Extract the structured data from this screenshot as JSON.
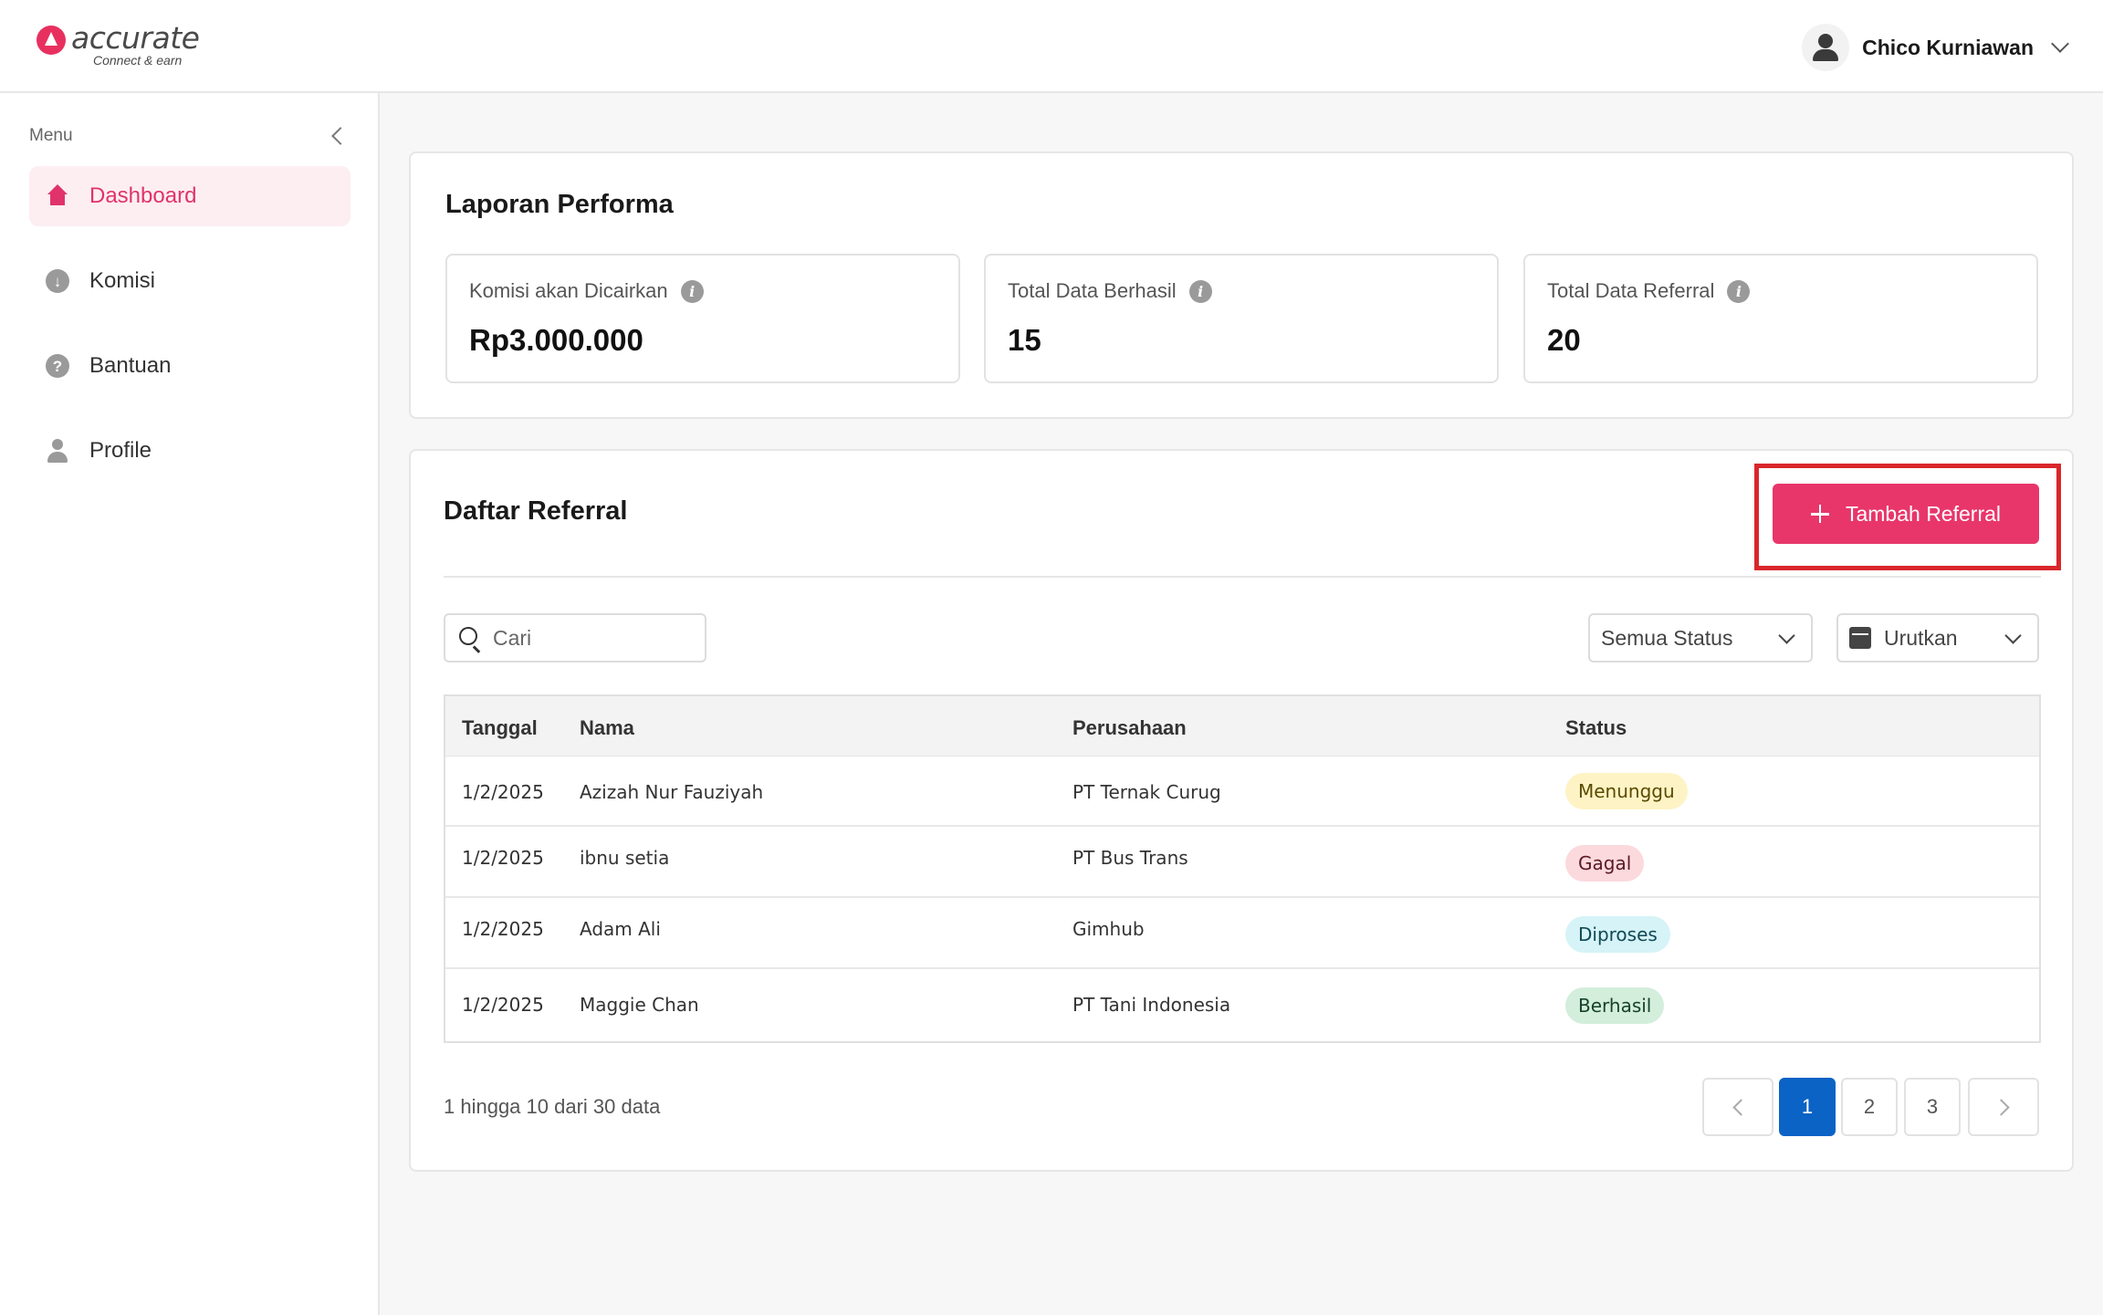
{
  "brand": {
    "name": "accurate",
    "tagline": "Connect & earn"
  },
  "header": {
    "user_name": "Chico Kurniawan"
  },
  "sidebar": {
    "menu_label": "Menu",
    "items": [
      {
        "label": "Dashboard",
        "icon": "home-icon",
        "active": true
      },
      {
        "label": "Komisi",
        "icon": "download-circle-icon",
        "active": false
      },
      {
        "label": "Bantuan",
        "icon": "help-circle-icon",
        "active": false
      },
      {
        "label": "Profile",
        "icon": "person-icon",
        "active": false
      }
    ]
  },
  "performance": {
    "title": "Laporan Performa",
    "stats": [
      {
        "label": "Komisi akan Dicairkan",
        "value": "Rp3.000.000"
      },
      {
        "label": "Total Data Berhasil",
        "value": "15"
      },
      {
        "label": "Total Data Referral",
        "value": "20"
      }
    ]
  },
  "referrals": {
    "title": "Daftar Referral",
    "add_button": "Tambah Referral",
    "search_placeholder": "Cari",
    "status_filter": "Semua Status",
    "sort_label": "Urutkan",
    "columns": [
      "Tanggal",
      "Nama",
      "Perusahaan",
      "Status"
    ],
    "rows": [
      {
        "date": "1/2/2025",
        "name": "Azizah Nur Fauziyah",
        "company": "PT Ternak Curug",
        "status": "Menunggu"
      },
      {
        "date": "1/2/2025",
        "name": "ibnu setia",
        "company": "PT Bus Trans",
        "status": "Gagal"
      },
      {
        "date": "1/2/2025",
        "name": "Adam Ali",
        "company": "Gimhub",
        "status": "Diproses"
      },
      {
        "date": "1/2/2025",
        "name": "Maggie Chan",
        "company": "PT Tani Indonesia",
        "status": "Berhasil"
      }
    ],
    "status_colors": {
      "Menunggu": {
        "bg": "#fdf3c4",
        "fg": "#5a4a00"
      },
      "Gagal": {
        "bg": "#fbd9dd",
        "fg": "#5a1a22"
      },
      "Diproses": {
        "bg": "#d6f3f7",
        "fg": "#0e4a55"
      },
      "Berhasil": {
        "bg": "#d3eedb",
        "fg": "#16432a"
      }
    },
    "pagination": {
      "summary": "1 hingga 10 dari 30 data",
      "pages": [
        "1",
        "2",
        "3"
      ],
      "current": "1"
    }
  },
  "colors": {
    "accent": "#e8366a",
    "primary_blue": "#0b63c5",
    "highlight": "#d9262b"
  }
}
